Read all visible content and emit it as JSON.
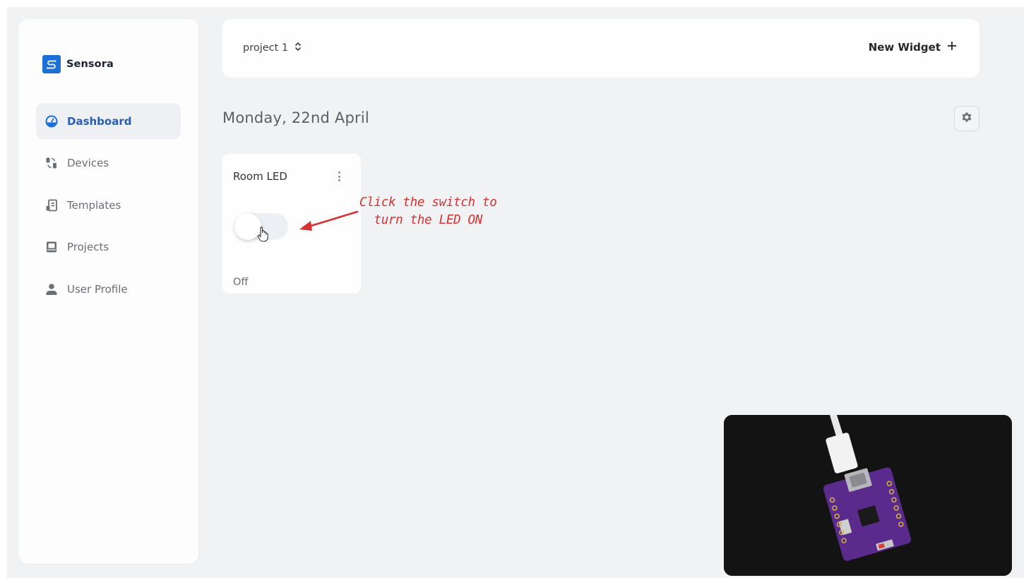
{
  "app": {
    "name": "Sensora",
    "logo_icon": "sensora-logo-icon"
  },
  "sidebar": {
    "items": [
      {
        "label": "Dashboard",
        "icon": "dashboard-gauge-icon",
        "active": true
      },
      {
        "label": "Devices",
        "icon": "devices-icon",
        "active": false
      },
      {
        "label": "Templates",
        "icon": "templates-icon",
        "active": false
      },
      {
        "label": "Projects",
        "icon": "projects-book-icon",
        "active": false
      },
      {
        "label": "User Profile",
        "icon": "user-icon",
        "active": false
      }
    ]
  },
  "topbar": {
    "project_selected": "project 1",
    "project_select_icon": "up-down-chevron-icon",
    "new_widget_label": "New Widget",
    "new_widget_icon": "plus-icon"
  },
  "main": {
    "date_title": "Monday, 22nd April",
    "settings_icon": "gear-icon"
  },
  "widgets": [
    {
      "title": "Room LED",
      "type": "switch",
      "state": "Off",
      "menu_icon": "kebab-menu-icon"
    }
  ],
  "annotation": {
    "line1": "Click the switch to",
    "line2": "turn the LED ON",
    "color": "#d93030"
  },
  "video_overlay": {
    "description": "purple microcontroller board connected to white USB-C cable"
  },
  "colors": {
    "accent": "#1c6fd6",
    "active_nav_text": "#2a5fb8",
    "page_background": "#f0f2f4"
  }
}
